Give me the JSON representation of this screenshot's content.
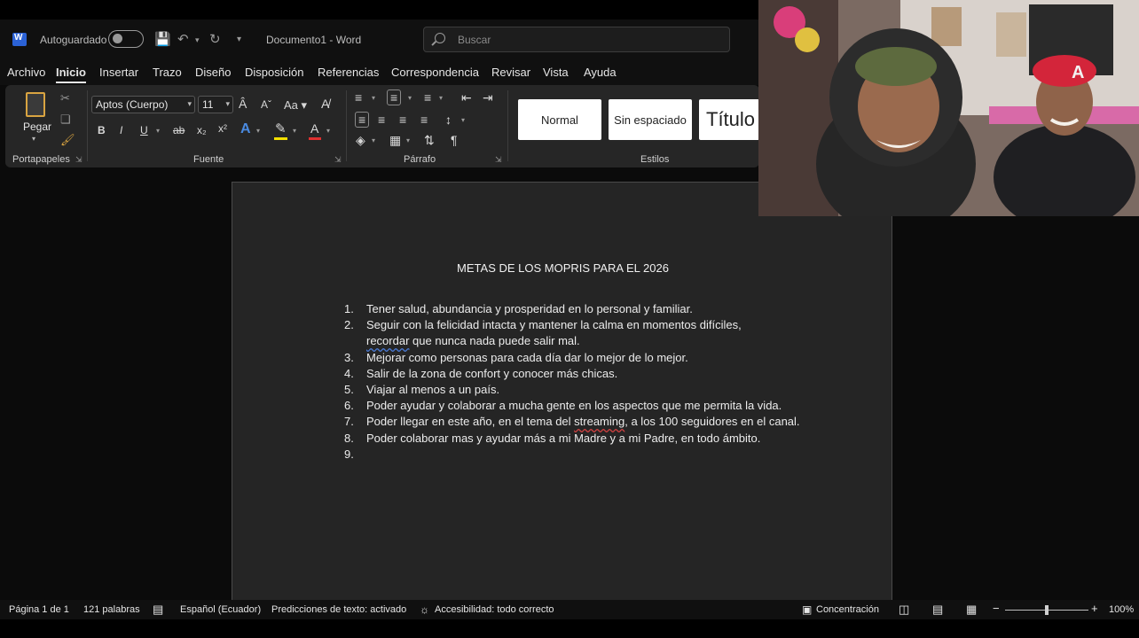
{
  "titlebar": {
    "autosave_label": "Autoguardado",
    "document_title": "Documento1  -  Word",
    "search_placeholder": "Buscar"
  },
  "menu": {
    "tabs": [
      "Archivo",
      "Inicio",
      "Insertar",
      "Trazo",
      "Diseño",
      "Disposición",
      "Referencias",
      "Correspondencia",
      "Revisar",
      "Vista",
      "Ayuda"
    ],
    "active": "Inicio"
  },
  "ribbon": {
    "clipboard": {
      "paste_label": "Pegar",
      "group_label": "Portapapeles"
    },
    "font": {
      "font_name": "Aptos (Cuerpo)",
      "font_size": "11",
      "case_label": "Aa",
      "bold": "B",
      "italic": "I",
      "underline": "U",
      "strike": "ab",
      "group_label": "Fuente"
    },
    "paragraph": {
      "group_label": "Párrafo"
    },
    "styles": {
      "normal": "Normal",
      "no_spacing": "Sin espaciado",
      "title": "Título",
      "group_label": "Estilos"
    }
  },
  "document": {
    "heading": "METAS DE LOS MOPRIS PARA EL 2026",
    "goals": [
      {
        "num": "1.",
        "text": "Tener salud, abundancia y prosperidad en lo personal y familiar."
      },
      {
        "num": "2.",
        "text_line1": "Seguir con la felicidad intacta y mantener la calma en momentos difíciles,",
        "text_squiggle": "recordar",
        "text_line2": " que nunca nada puede salir mal."
      },
      {
        "num": "3.",
        "text": "Mejorar como personas para cada día dar lo mejor de lo mejor."
      },
      {
        "num": "4.",
        "text": "Salir de la zona de confort y conocer más chicas."
      },
      {
        "num": "5.",
        "text": "Viajar al menos a un país."
      },
      {
        "num": "6.",
        "text": "Poder ayudar y colaborar a mucha gente en los aspectos que me permita la vida."
      },
      {
        "num": "7.",
        "text_pre": "Poder llegar en este año, en el tema del ",
        "text_squiggle": "streaming",
        "text_post": ", a los 100 seguidores en el canal."
      },
      {
        "num": "8.",
        "text": "Poder colaborar mas y ayudar más a mi Madre y a mi Padre, en todo ámbito."
      },
      {
        "num": "9.",
        "text": ""
      }
    ]
  },
  "statusbar": {
    "page": "Página 1 de 1",
    "words": "121 palabras",
    "language": "Español (Ecuador)",
    "predictions": "Predicciones de texto: activado",
    "accessibility": "Accesibilidad: todo correcto",
    "focus": "Concentración",
    "zoom": "100%"
  },
  "colors": {
    "accent_word": "#2b62d6",
    "chrome_bg": "#101010",
    "ribbon_bg": "#262626",
    "page_bg": "#252525"
  }
}
